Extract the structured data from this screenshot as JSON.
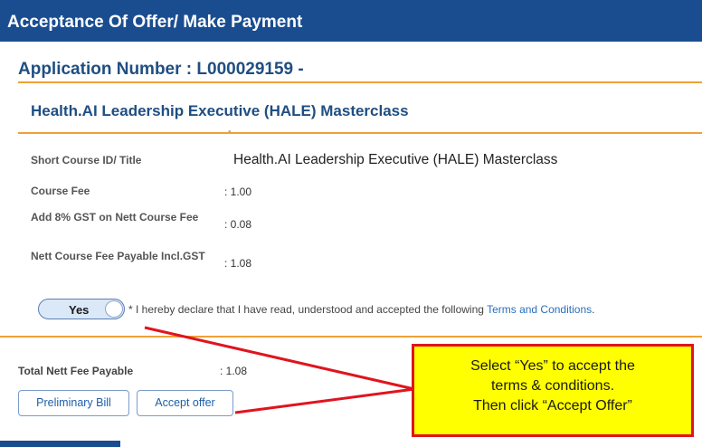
{
  "header": {
    "title": "Acceptance Of Offer/ Make Payment"
  },
  "application": {
    "number_label": "Application Number : L000029159 -"
  },
  "course": {
    "title": "Health.AI Leadership Executive (HALE) Masterclass",
    "dash": "-"
  },
  "details": [
    {
      "label": "Short Course ID/ Title",
      "value": "Health.AI Leadership Executive (HALE) Masterclass"
    },
    {
      "label": "Course Fee",
      "value": ": 1.00"
    },
    {
      "label": "Add 8% GST on Nett Course Fee",
      "value": ": 0.08"
    },
    {
      "label": "Nett Course Fee Payable Incl.GST",
      "value": ": 1.08"
    }
  ],
  "declaration": {
    "toggle_label": "Yes",
    "text": "* I hereby declare that I have read, understood and accepted the following",
    "link": "Terms and Conditions",
    "period": "."
  },
  "total": {
    "label": "Total Nett Fee Payable",
    "value": ": 1.08"
  },
  "buttons": {
    "preliminary_bill": "Preliminary Bill",
    "accept_offer": "Accept offer"
  },
  "callout": {
    "line1": "Select “Yes” to accept the",
    "line2": "terms & conditions.",
    "line3": "Then click “Accept Offer”"
  },
  "colors": {
    "header": "#1a4d8f",
    "accent": "#f0a035",
    "callout_bg": "#ffff00",
    "callout_border": "#e0141e"
  }
}
